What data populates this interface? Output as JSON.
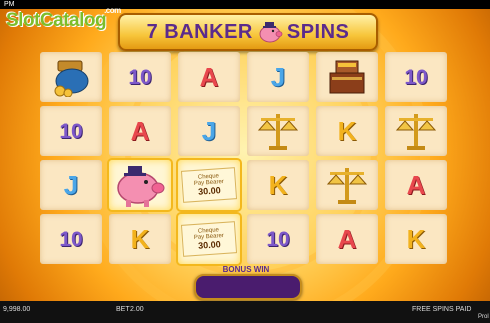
{
  "status_bar": {
    "time": "PM"
  },
  "watermark": {
    "text": "SlotCatalog",
    "suffix": ".com"
  },
  "title": {
    "left": "7 BANKER",
    "right": "SPINS"
  },
  "grid": {
    "columns": [
      [
        "purse",
        "10",
        "J",
        "10"
      ],
      [
        "10",
        "A",
        "pig",
        "K"
      ],
      [
        "A",
        "J",
        "cheque",
        "cheque"
      ],
      [
        "J",
        "scales",
        "K",
        "10"
      ],
      [
        "register",
        "K",
        "scales",
        "A"
      ],
      [
        "10",
        "scales",
        "A",
        "K"
      ]
    ],
    "cheque": {
      "word": "Cheque",
      "amount": "30.00",
      "note": "Pay Bearer"
    }
  },
  "bonus": {
    "label": "BONUS WIN",
    "value": ""
  },
  "footer": {
    "balance": "9,998.00",
    "bet_label": "BET",
    "bet_value": "2.00",
    "message": "FREE SPINS PAID",
    "brand": "Prol"
  }
}
